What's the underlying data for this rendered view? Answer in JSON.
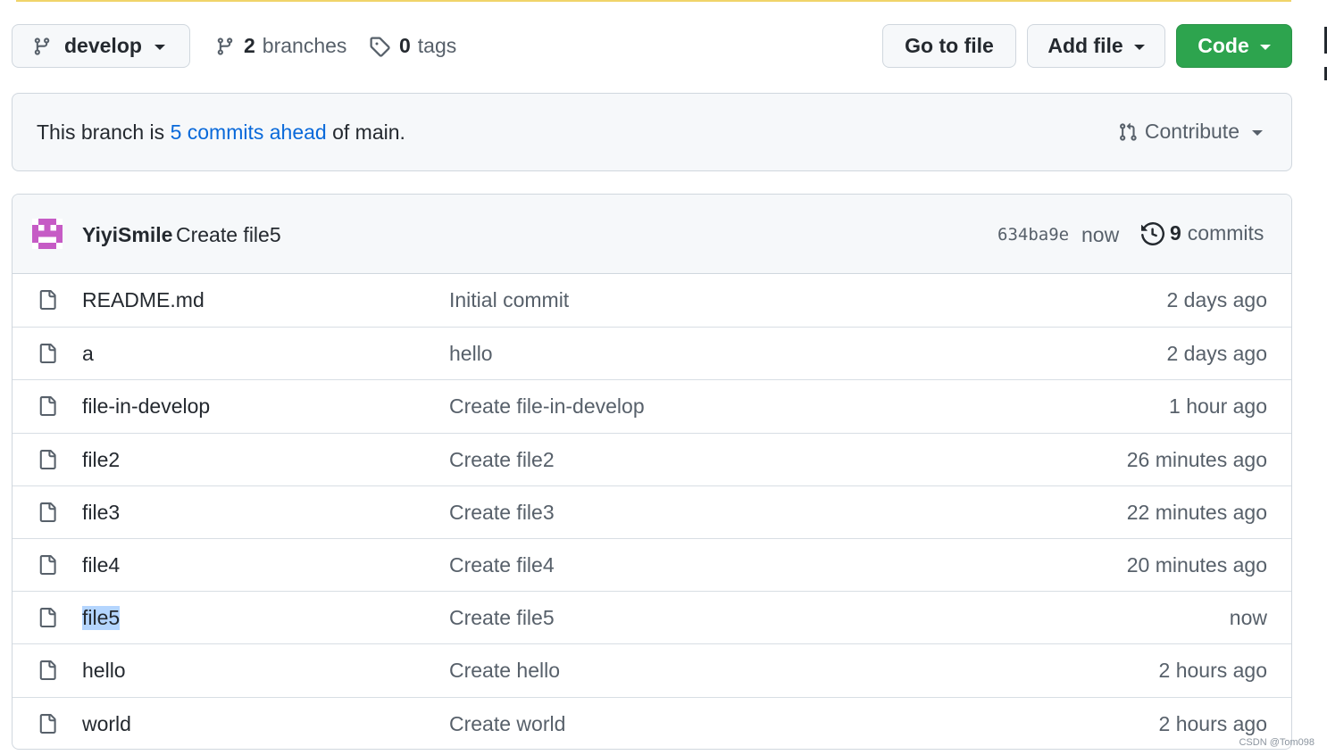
{
  "toolbar": {
    "branch": "develop",
    "branches_count": "2",
    "branches_label": "branches",
    "tags_count": "0",
    "tags_label": "tags",
    "go_to_file": "Go to file",
    "add_file": "Add file",
    "code": "Code"
  },
  "ahead": {
    "prefix": "This branch is",
    "link": "5 commits ahead",
    "suffix": "of main.",
    "contribute": "Contribute"
  },
  "commit": {
    "author": "YiyiSmile",
    "message": "Create file5",
    "sha": "634ba9e",
    "time": "now",
    "count": "9",
    "count_label": "commits"
  },
  "files": [
    {
      "name": "README.md",
      "message": "Initial commit",
      "age": "2 days ago"
    },
    {
      "name": "a",
      "message": "hello",
      "age": "2 days ago"
    },
    {
      "name": "file-in-develop",
      "message": "Create file-in-develop",
      "age": "1 hour ago"
    },
    {
      "name": "file2",
      "message": "Create file2",
      "age": "26 minutes ago"
    },
    {
      "name": "file3",
      "message": "Create file3",
      "age": "22 minutes ago"
    },
    {
      "name": "file4",
      "message": "Create file4",
      "age": "20 minutes ago"
    },
    {
      "name": "file5",
      "message": "Create file5",
      "age": "now",
      "selected": true
    },
    {
      "name": "hello",
      "message": "Create hello",
      "age": "2 hours ago"
    },
    {
      "name": "world",
      "message": "Create world",
      "age": "2 hours ago"
    }
  ],
  "watermark": "CSDN @Tom098",
  "colors": {
    "primary_green": "#2da44e",
    "link_blue": "#0969da",
    "muted_text": "#57606a",
    "selection": "#b4d5fe"
  }
}
